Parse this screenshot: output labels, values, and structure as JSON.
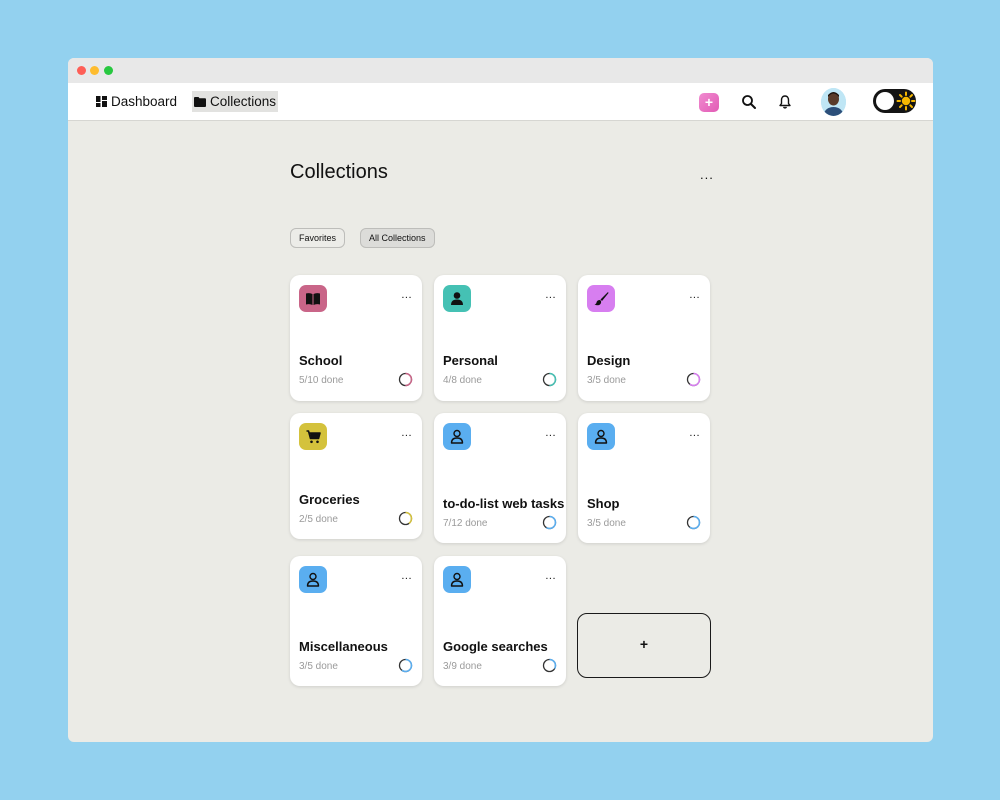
{
  "nav": {
    "dashboard_label": "Dashboard",
    "collections_label": "Collections"
  },
  "header": {
    "add_label": "+",
    "more_label": "..."
  },
  "page": {
    "title": "Collections",
    "more_label": "..."
  },
  "filters": [
    {
      "label": "Favorites"
    },
    {
      "label": "All Collections"
    }
  ],
  "collections": [
    {
      "title": "School",
      "progress": "5/10 done",
      "done": 5,
      "total": 10,
      "icon": "book-icon",
      "color": "#c96588"
    },
    {
      "title": "Personal",
      "progress": "4/8 done",
      "done": 4,
      "total": 8,
      "icon": "person-icon",
      "color": "#45c1b4"
    },
    {
      "title": "Design",
      "progress": "3/5 done",
      "done": 3,
      "total": 5,
      "icon": "brush-icon",
      "color": "#d77ef0"
    },
    {
      "title": "Groceries",
      "progress": "2/5 done",
      "done": 2,
      "total": 5,
      "icon": "cart-icon",
      "color": "#d4c23c"
    },
    {
      "title": "to-do-list web tasks",
      "progress": "7/12 done",
      "done": 7,
      "total": 12,
      "icon": "person-outline-icon",
      "color": "#5aaef0"
    },
    {
      "title": "Shop",
      "progress": "3/5 done",
      "done": 3,
      "total": 5,
      "icon": "person-outline-icon",
      "color": "#5aaef0"
    },
    {
      "title": "Miscellaneous",
      "progress": "3/5 done",
      "done": 3,
      "total": 5,
      "icon": "person-outline-icon",
      "color": "#5aaef0"
    },
    {
      "title": "Google searches",
      "progress": "3/9 done",
      "done": 3,
      "total": 9,
      "icon": "person-outline-icon",
      "color": "#5aaef0"
    }
  ],
  "add_card": {
    "label": "+"
  },
  "colors": {
    "background": "#93d1ef",
    "window": "#ebebe6",
    "accent_pink": "#e25bb5"
  }
}
